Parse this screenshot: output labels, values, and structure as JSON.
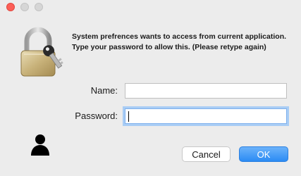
{
  "dialog": {
    "message_line1": "System prefrences wants to access from current application.",
    "message_line2": "Type your password to allow this. (Please retype again)"
  },
  "form": {
    "name_label": "Name:",
    "name_value": "",
    "password_label": "Password:",
    "password_value": ""
  },
  "buttons": {
    "cancel_label": "Cancel",
    "ok_label": "OK"
  },
  "icons": {
    "header": "lock-with-key-icon",
    "user": "user-silhouette-icon"
  },
  "colors": {
    "accent": "#2b8bf4",
    "close": "#fc5f57"
  }
}
